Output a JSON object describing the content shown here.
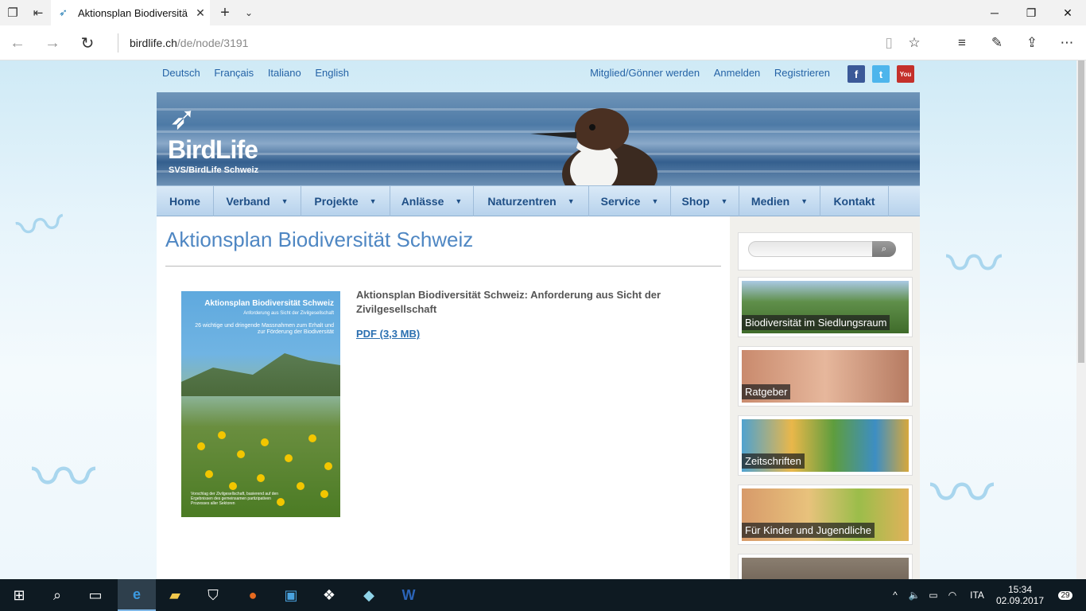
{
  "browser": {
    "tab_title": "Aktionsplan Biodiversitä",
    "url_host": "birdlife.ch",
    "url_path": "/de/node/3191"
  },
  "toplinks": {
    "languages": [
      "Deutsch",
      "Français",
      "Italiano",
      "English"
    ],
    "account": [
      "Mitglied/Gönner werden",
      "Anmelden",
      "Registrieren"
    ]
  },
  "logo": {
    "name": "BirdLife",
    "sub": "SVS/BirdLife Schweiz"
  },
  "nav": [
    "Home",
    "Verband",
    "Projekte",
    "Anlässe",
    "Naturzentren",
    "Service",
    "Shop",
    "Medien",
    "Kontakt"
  ],
  "page": {
    "title": "Aktionsplan Biodiversität Schweiz",
    "doc_title": "Aktionsplan Biodiversität Schweiz: Anforderung aus Sicht der Zivilgesellschaft",
    "doc_link": "PDF (3,3 MB)",
    "cover": {
      "title": "Aktionsplan Biodiversität Schweiz",
      "subtitle": "Anforderung aus Sicht der Zivilgesellschaft",
      "text": "26 wichtige und dringende Massnahmen zum Erhalt und zur Förderung der Biodiversität",
      "footer": "Vorschlag der Zivilgesellschaft, basierend auf den Ergebnissen des gemeinsamen partizipativen Prozesses aller Sektoren"
    }
  },
  "sidebar": {
    "teasers": [
      "Biodiversität im Siedlungsraum",
      "Ratgeber",
      "Zeitschriften",
      "Für Kinder und Jugendliche"
    ]
  },
  "taskbar": {
    "lang": "ITA",
    "time": "15:34",
    "date": "02.09.2017",
    "notifications": "29"
  }
}
